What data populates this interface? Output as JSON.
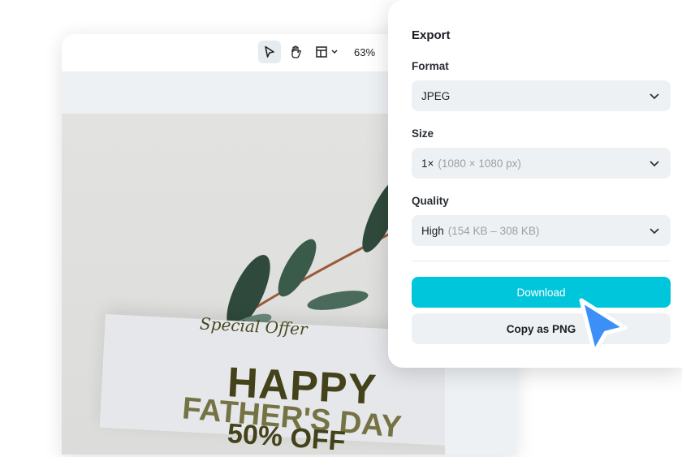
{
  "toolbar": {
    "zoom": "63%"
  },
  "design": {
    "special": "Special Offer",
    "happy": "HAPPY",
    "fathers": "FATHER'S DAY",
    "off": "50% OFF"
  },
  "export": {
    "title": "Export",
    "format_label": "Format",
    "format_value": "JPEG",
    "size_label": "Size",
    "size_value": "1×",
    "size_hint": "(1080 × 1080 px)",
    "quality_label": "Quality",
    "quality_value": "High",
    "quality_hint": "(154 KB – 308 KB)",
    "download": "Download",
    "copy_png": "Copy as PNG"
  },
  "colors": {
    "accent": "#00c6dc",
    "cursor": "#3b8ff7"
  }
}
